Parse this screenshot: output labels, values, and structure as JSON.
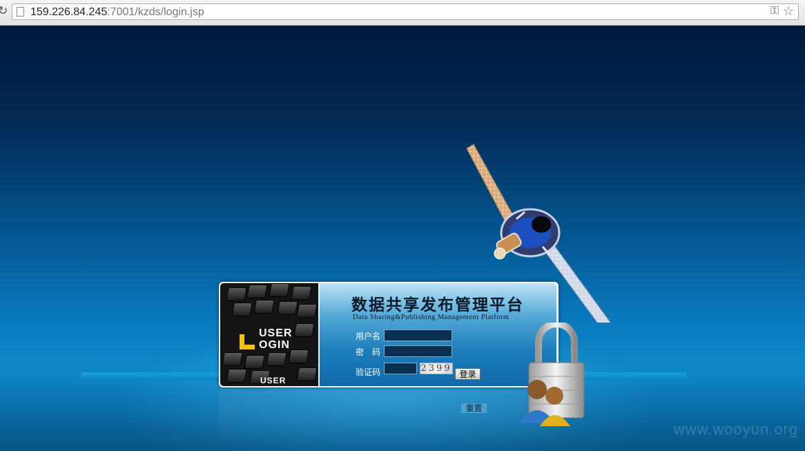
{
  "browser": {
    "url_host": "159.226.84.245",
    "url_path": ":7001/kzds/login.jsp"
  },
  "login": {
    "title_cn": "数据共享发布管理平台",
    "title_en": "Data Sharing&Publishing Management Platform",
    "username_label": "用户名",
    "password_label": "密　码",
    "captcha_label": "验证码",
    "username_value": "",
    "password_value": "",
    "captcha_value": "",
    "captcha_code": "2399",
    "login_button": "登录",
    "reset_button": "重置"
  },
  "logo": {
    "line1": "USER",
    "line2": "OGIN",
    "partial": "USER"
  },
  "watermark": "www.wooyun.org",
  "colors": {
    "bg_top": "#00183a",
    "bg_bottom": "#0e86c6",
    "logo_accent": "#f5c400"
  }
}
